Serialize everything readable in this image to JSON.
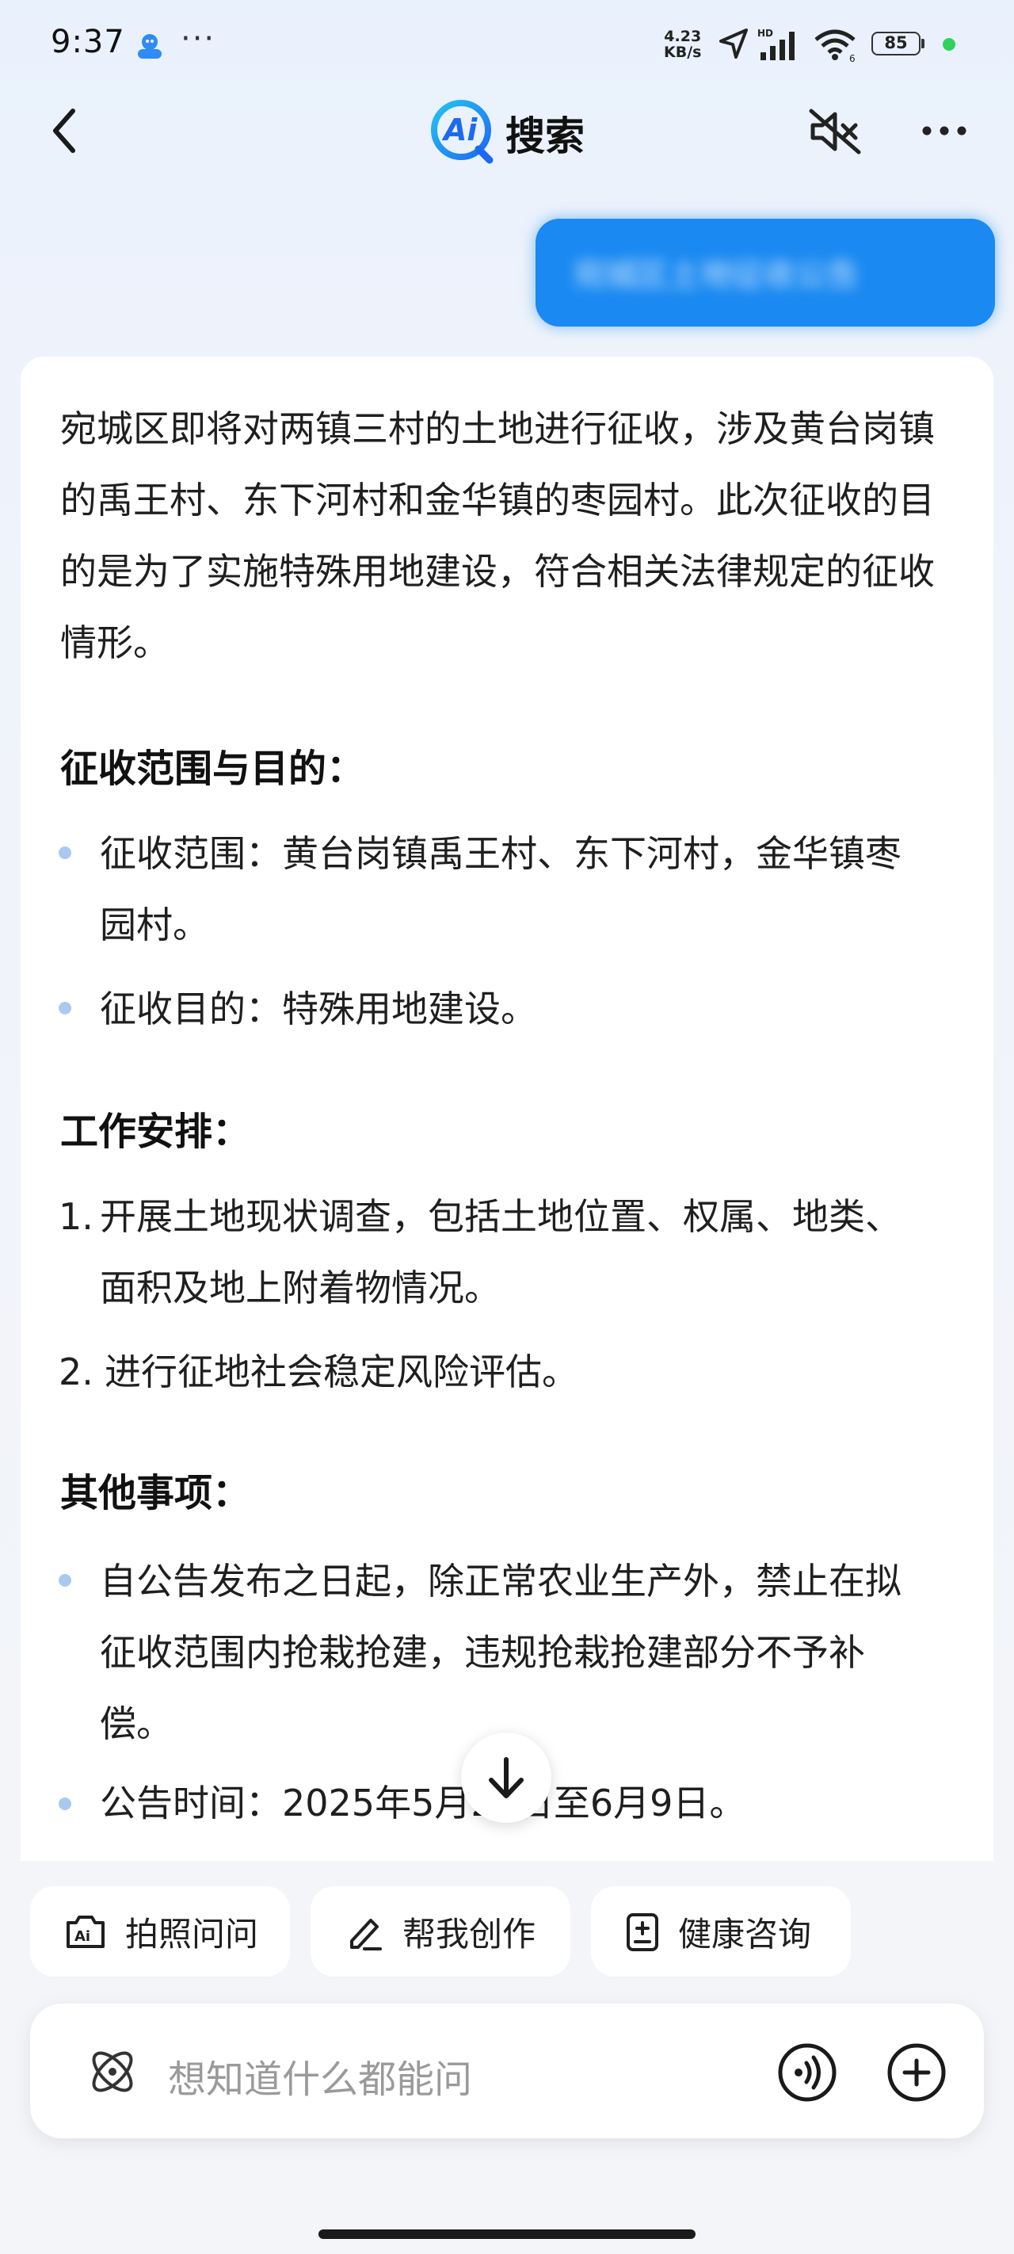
{
  "status_bar": {
    "time": "9:37",
    "dots": "···",
    "net_speed_value": "4.23",
    "net_speed_unit": "KB/s",
    "battery": "85"
  },
  "header": {
    "back_icon": "chevron-left-icon",
    "logo_text": "Ai",
    "title": "搜索",
    "mute_icon": "speaker-muted-icon",
    "more_icon": "more-icon"
  },
  "user_message": {
    "text": "宛城区土地征收公告"
  },
  "answer": {
    "intro": "宛城区即将对两镇三村的土地进行征收，涉及黄台岗镇的禹王村、东下河村和金华镇的枣园村。此次征收的目的是为了实施特殊用地建设，符合相关法律规定的征收情形。",
    "section1": {
      "heading": "征收范围与目的：",
      "items": [
        "征收范围：黄台岗镇禹王村、东下河村，金华镇枣园村。",
        "征收目的：特殊用地建设。"
      ]
    },
    "section2": {
      "heading": "工作安排：",
      "items": [
        {
          "num": "1.",
          "text": "开展土地现状调查，包括土地位置、权属、地类、面积及地上附着物情况。"
        },
        {
          "num": "2.",
          "text": "进行征地社会稳定风险评估。"
        }
      ]
    },
    "section3": {
      "heading": "其他事项：",
      "items": [
        "自公告发布之日起，除正常农业生产外，禁止在拟征收范围内抢栽抢建，违规抢栽抢建部分不予补偿。",
        "公告时间：2025年5月26日至6月9日。"
      ]
    }
  },
  "quick_actions": [
    {
      "icon": "ai-camera-icon",
      "label": "拍照问问"
    },
    {
      "icon": "pen-icon",
      "label": "帮我创作"
    },
    {
      "icon": "health-clipboard-icon",
      "label": "健康咨询"
    }
  ],
  "input": {
    "placeholder": "想知道什么都能问",
    "voice_icon": "voice-wave-icon",
    "add_icon": "plus-circle-icon"
  },
  "colors": {
    "accent": "#1a89f1",
    "bullet": "#a9c9f1",
    "battery_dot": "#2fd35a"
  }
}
